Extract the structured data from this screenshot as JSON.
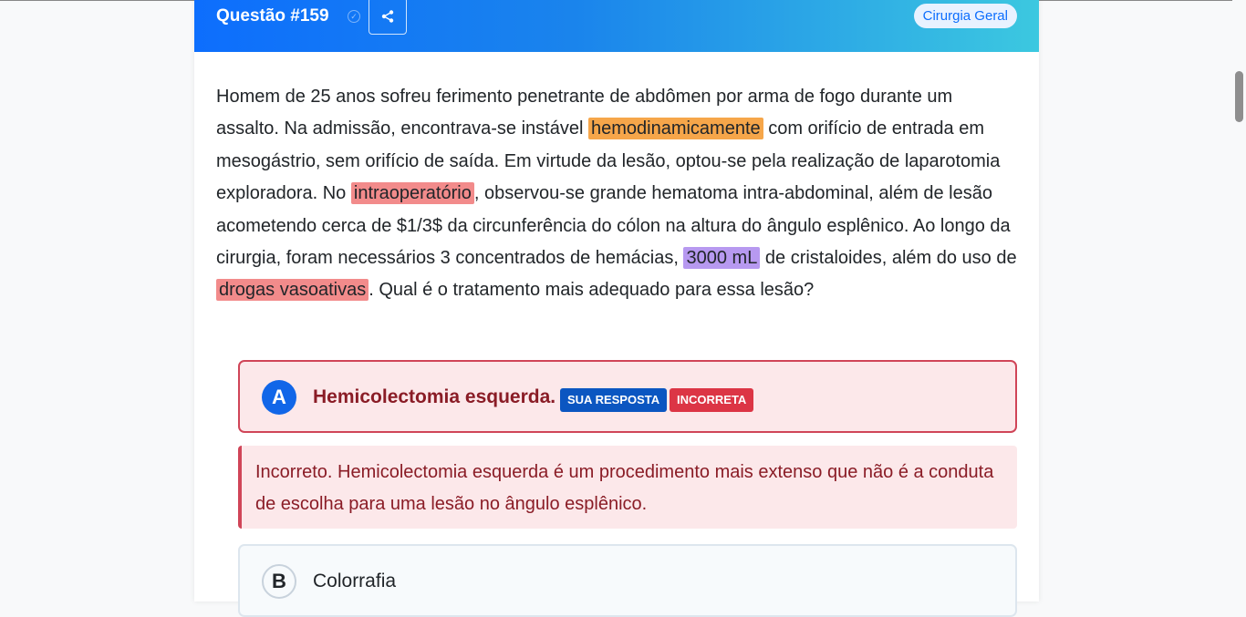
{
  "header": {
    "title": "Questão #159",
    "tag": "Cirurgia Geral"
  },
  "question": {
    "parts": [
      "Homem de 25 anos sofreu ferimento penetrante de abdômen por arma de fogo durante um assalto. Na admissão, encontrava-se instável ",
      "hemodinamicamente",
      " com orifício de entrada em mesogástrio, sem orifício de saída. Em virtude da lesão, optou-se pela realização de laparotomia exploradora. No ",
      "intraoperatório",
      ", observou-se grande hematoma intra-abdominal, além de lesão acometendo cerca de $1/3$ da circunferência do cólon na altura do ângulo esplênico. Ao longo da cirurgia, foram necessários 3 concentrados de hemácias, ",
      "3000 mL",
      " de cristaloides, além do uso de ",
      "drogas vasoativas",
      ". Qual é o tratamento mais adequado para essa lesão?"
    ]
  },
  "options": [
    {
      "letter": "A",
      "text": "Hemicolectomia esquerda.",
      "badge_answer": "SUA RESPOSTA",
      "badge_status": "INCORRETA",
      "feedback": "Incorreto. Hemicolectomia esquerda é um procedimento mais extenso que não é a conduta de escolha para uma lesão no ângulo esplênico."
    },
    {
      "letter": "B",
      "text": "Colorrafia"
    }
  ],
  "colors": {
    "header_start": "#0d6efd",
    "header_end": "#3cc8e0",
    "highlight_orange": "#f6a64a",
    "highlight_red": "#f28b8b",
    "highlight_purple": "#b799f0",
    "incorrect": "#dc3545",
    "answer_badge": "#0b56c1"
  },
  "icons": {
    "verified": "check-circle-icon",
    "share": "share-icon"
  }
}
